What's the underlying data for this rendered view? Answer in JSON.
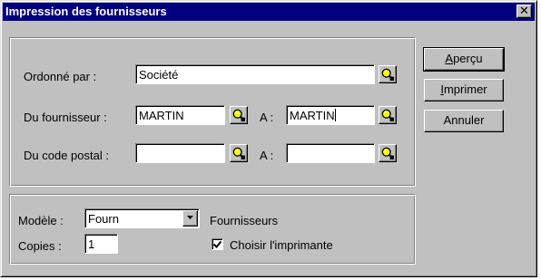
{
  "window": {
    "title": "Impression des fournisseurs",
    "close_glyph": "✕"
  },
  "criteria": {
    "sort_label": "Ordonné par :",
    "sort_value": "Société",
    "supplier_label": "Du fournisseur :",
    "supplier_from": "MARTIN",
    "supplier_to_label": "A :",
    "supplier_to": "MARTIN",
    "postal_label": "Du code postal :",
    "postal_from": "",
    "postal_to_label": "A :",
    "postal_to": ""
  },
  "output": {
    "model_label": "Modèle :",
    "model_value": "Fourn",
    "model_description": "Fournisseurs",
    "copies_label": "Copies :",
    "copies_value": "1",
    "choose_printer_label": "Choisir l'imprimante",
    "choose_printer_checked": true
  },
  "buttons": {
    "preview_first": "A",
    "preview_rest": "perçu",
    "print_first": "I",
    "print_rest": "mprimer",
    "cancel": "Annuler"
  },
  "icons": {
    "lookup": "magnifier-icon",
    "dropdown": "chevron-down-icon",
    "check": "checkmark-icon",
    "close": "close-icon"
  },
  "colors": {
    "titlebar": "#000080",
    "face": "#c0c0c0",
    "magnifier_lens": "#ffff00"
  }
}
